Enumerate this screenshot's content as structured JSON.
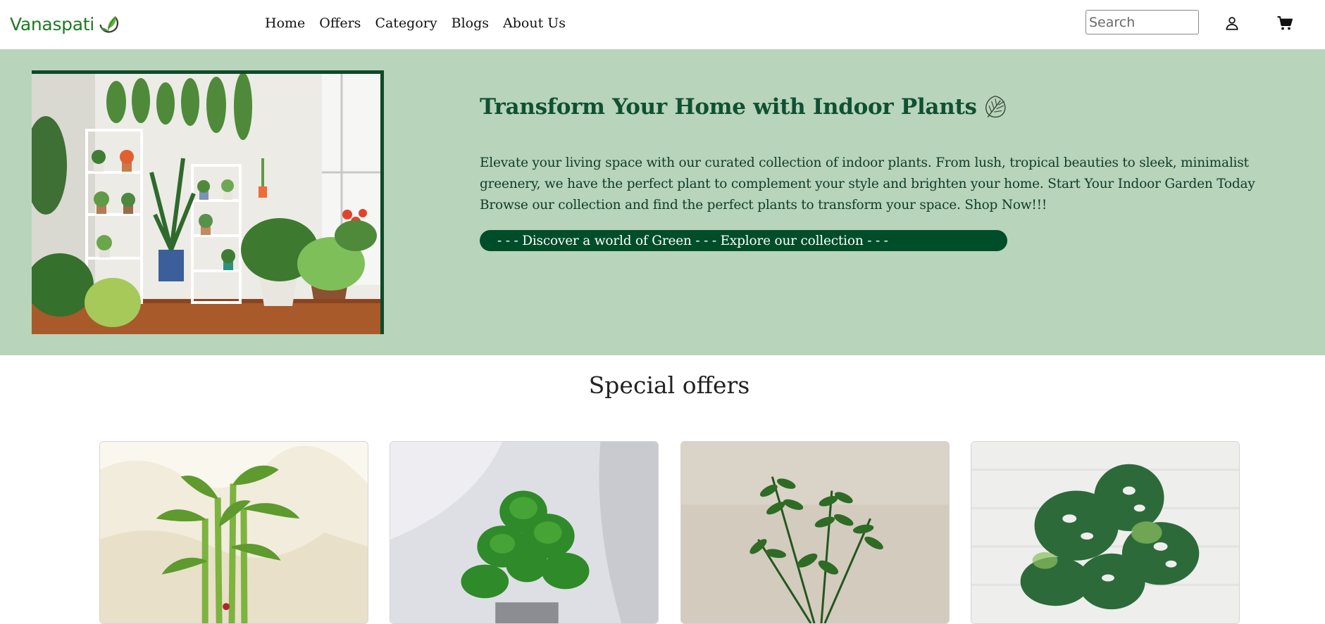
{
  "navbar": {
    "brand": "Vanaspati",
    "links": [
      "Home",
      "Offers",
      "Category",
      "Blogs",
      "About Us"
    ],
    "search_placeholder": "Search",
    "icons": {
      "user": "user-icon",
      "cart": "cart-icon"
    }
  },
  "hero": {
    "title": "Transform Your Home with Indoor Plants",
    "title_icon": "monstera-leaf-icon",
    "description": "Elevate your living space with our curated collection of indoor plants. From lush, tropical beauties to sleek, minimalist greenery, we have the perfect plant to complement your style and brighten your home. Start Your Indoor Garden Today Browse our collection and find the perfect plants to transform your space. Shop Now!!!",
    "button_label": "- - - Discover a world of Green - - - Explore our collection - - -"
  },
  "offers": {
    "title": "Special offers",
    "cards": [
      {
        "image": "lucky-bamboo-plant"
      },
      {
        "image": "peperomia-plant"
      },
      {
        "image": "zz-plant"
      },
      {
        "image": "monstera-adansonii-plant"
      }
    ]
  },
  "colors": {
    "brand_green": "#1f7a1f",
    "hero_bg": "#b8d4bb",
    "heading_green": "#0f5132",
    "button_green": "#004d2a",
    "frame_green": "#0e4a28"
  }
}
